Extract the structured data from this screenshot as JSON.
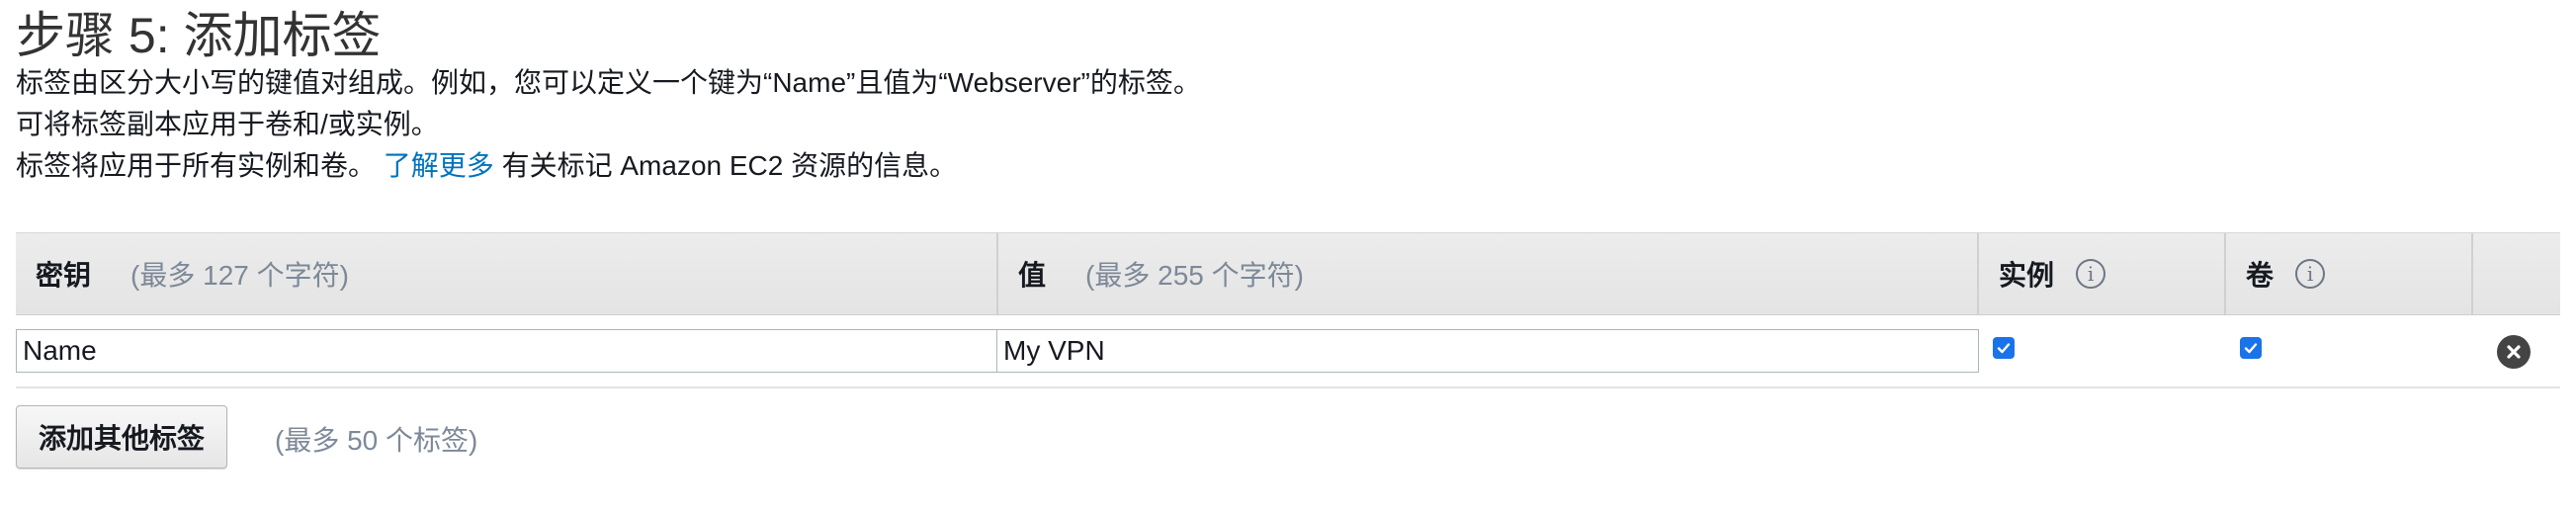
{
  "header": {
    "title": "步骤 5: 添加标签"
  },
  "description": {
    "line1": "标签由区分大小写的键值对组成。例如，您可以定义一个键为“Name”且值为“Webserver”的标签。",
    "line2": "可将标签副本应用于卷和/或实例。",
    "line3_prefix": "标签将应用于所有实例和卷。",
    "line3_link": "了解更多",
    "line3_suffix": "有关标记 Amazon EC2 资源的信息。"
  },
  "table": {
    "columns": {
      "key_label": "密钥",
      "key_hint": "(最多 127 个字符)",
      "value_label": "值",
      "value_hint": "(最多 255 个字符)",
      "instances_label": "实例",
      "volumes_label": "卷"
    },
    "rows": [
      {
        "key": "Name",
        "value": "My VPN",
        "instances": true,
        "volumes": true
      }
    ]
  },
  "footer": {
    "add_button": "添加其他标签",
    "limit_hint": "(最多 50 个标签)"
  },
  "icons": {
    "info": "info-icon",
    "checkbox": "checkbox-checked-icon",
    "remove": "remove-circle-icon"
  },
  "colors": {
    "link": "#0073bb",
    "checkbox": "#1a73e8",
    "header_bg": "#e8e8e8"
  }
}
